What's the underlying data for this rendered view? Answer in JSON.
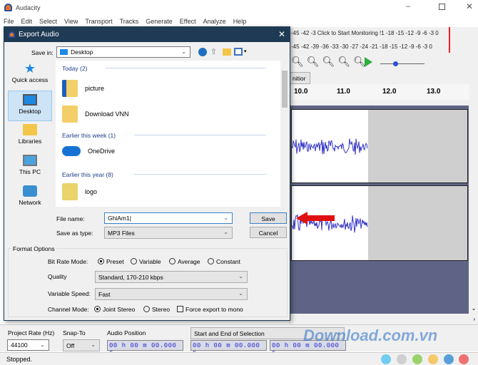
{
  "app": {
    "title": "Audacity"
  },
  "menu": [
    "File",
    "Edit",
    "Select",
    "View",
    "Transport",
    "Tracks",
    "Generate",
    "Effect",
    "Analyze",
    "Help"
  ],
  "meters": {
    "record": "-45 -42 -3 Click to Start Monitoring !1 -18 -15 -12  -9  -6  -3  0",
    "play": "-45 -42 -39 -36 -33 -30 -27 -24 -21 -18 -15 -12  -9  -6  -3  0"
  },
  "device_combo": "nitior",
  "ruler": [
    "10.0",
    "11.0",
    "12.0",
    "13.0"
  ],
  "dialog": {
    "title": "Export Audio",
    "save_in_label": "Save in:",
    "save_in_value": "Desktop",
    "places": [
      "Quick access",
      "Desktop",
      "Libraries",
      "This PC",
      "Network"
    ],
    "groups": [
      "Today (2)",
      "Earlier this week (1)",
      "Earlier this year (8)"
    ],
    "files": [
      "picture",
      "Download VNN",
      "OneDrive",
      "logo"
    ],
    "file_name_label": "File name:",
    "file_name_value": "GhiAm1",
    "save_type_label": "Save as type:",
    "save_type_value": "MP3 Files",
    "save_button": "Save",
    "cancel_button": "Cancel",
    "format_options": "Format Options",
    "bit_rate_label": "Bit Rate Mode:",
    "bit_rate_options": [
      "Preset",
      "Variable",
      "Average",
      "Constant"
    ],
    "quality_label": "Quality",
    "quality_value": "Standard, 170-210 kbps",
    "speed_label": "Variable Speed:",
    "speed_value": "Fast",
    "channel_label": "Channel Mode:",
    "channel_options": [
      "Joint Stereo",
      "Stereo"
    ],
    "force_mono": "Force export to mono"
  },
  "bottom": {
    "rate_label": "Project Rate (Hz)",
    "rate_value": "44100",
    "snap_label": "Snap-To",
    "snap_value": "Off",
    "pos_label": "Audio Position",
    "pos_value": "00 h 00 m 00.000 s",
    "sel_label": "Start and End of Selection",
    "sel_start": "00 h 00 m 00.000 s",
    "sel_end": "00 h 00 m 00.000 s"
  },
  "status": "Stopped.",
  "watermark": "Download.com.vn",
  "colors": {
    "dialog_title": "#1f3a55",
    "track_bg": "#5f6385",
    "waveform": "#3232c8",
    "arrow": "#e01010"
  }
}
